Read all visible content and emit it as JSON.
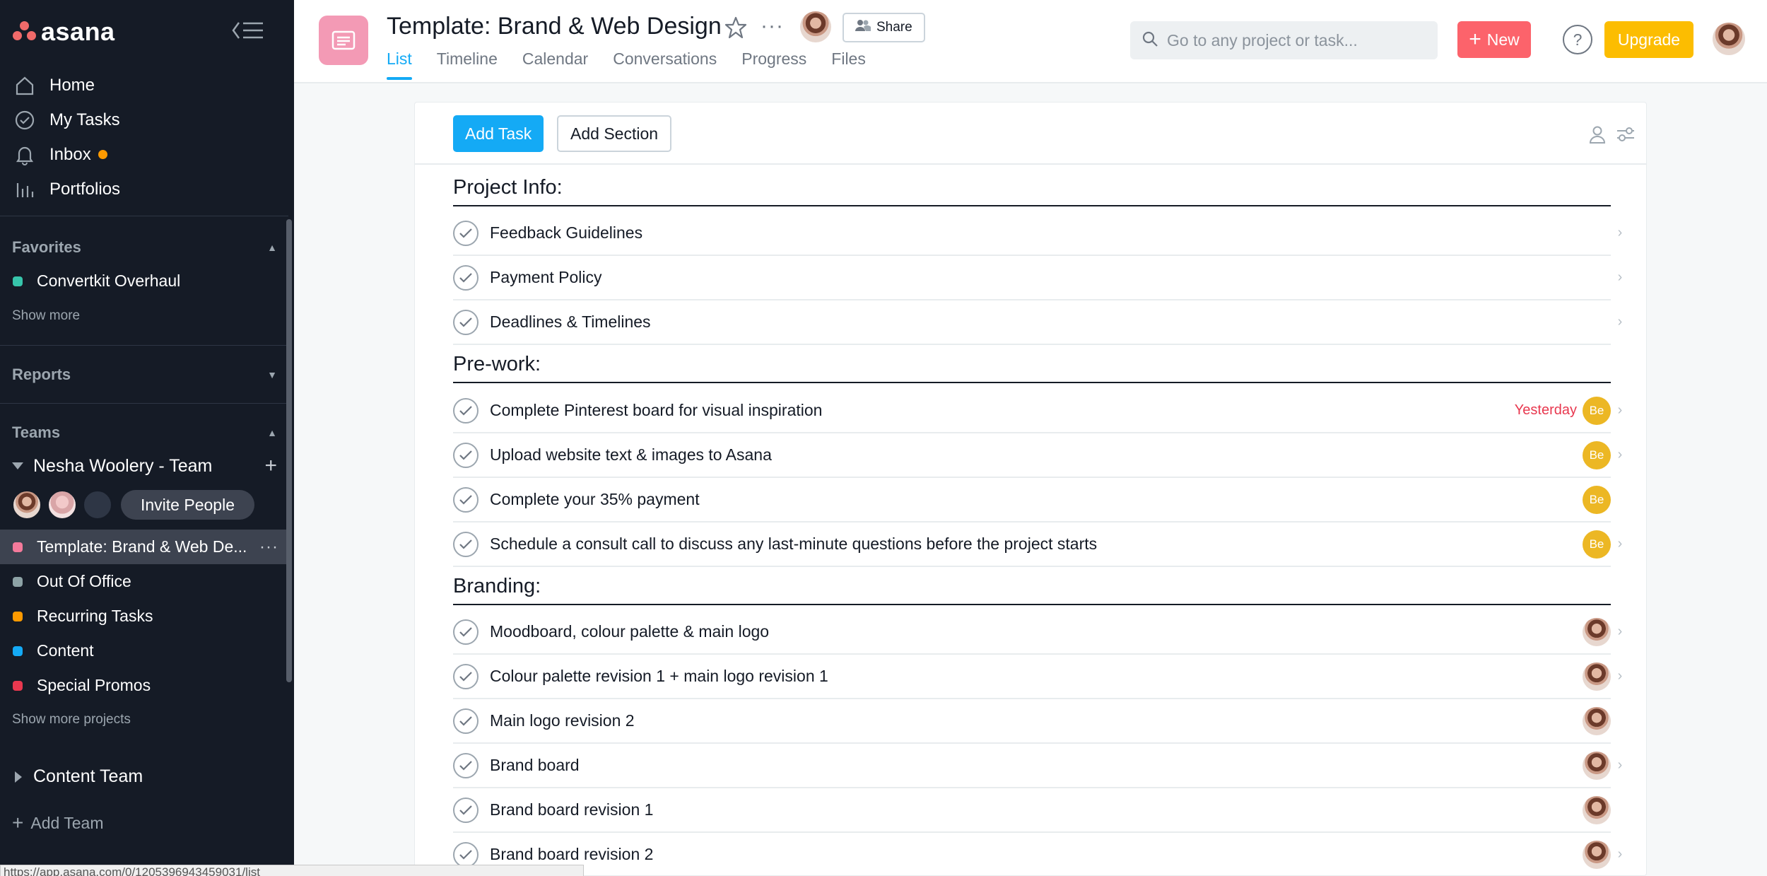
{
  "sidebar": {
    "brand": "asana",
    "nav": [
      {
        "label": "Home",
        "icon": "home-icon"
      },
      {
        "label": "My Tasks",
        "icon": "check-circle-icon"
      },
      {
        "label": "Inbox",
        "icon": "bell-icon"
      },
      {
        "label": "Portfolios",
        "icon": "bar-chart-icon"
      }
    ],
    "favorites": {
      "title": "Favorites",
      "items": [
        {
          "label": "Convertkit Overhaul",
          "color": "#37c5ab"
        }
      ],
      "show_more": "Show more"
    },
    "reports": {
      "title": "Reports"
    },
    "teams": {
      "title": "Teams",
      "team_name": "Nesha Woolery - Team",
      "invite": "Invite People",
      "projects": [
        {
          "label": "Template: Brand & Web De...",
          "color": "#f47a9b"
        },
        {
          "label": "Out Of Office",
          "color": "#8da3a6"
        },
        {
          "label": "Recurring Tasks",
          "color": "#fd9a00"
        },
        {
          "label": "Content",
          "color": "#14aaf5"
        },
        {
          "label": "Special Promos",
          "color": "#e8384f"
        }
      ],
      "show_more_projects": "Show more projects",
      "other_team": "Content Team",
      "add_team": "Add Team"
    }
  },
  "header": {
    "title": "Template: Brand & Web Design",
    "share": "Share",
    "tabs": [
      "List",
      "Timeline",
      "Calendar",
      "Conversations",
      "Progress",
      "Files"
    ],
    "search_placeholder": "Go to any project or task...",
    "new": "New",
    "help": "?",
    "upgrade": "Upgrade"
  },
  "actions": {
    "add_task": "Add Task",
    "add_section": "Add Section"
  },
  "sections": [
    {
      "title": "Project Info:",
      "tasks": [
        {
          "name": "Feedback Guidelines"
        },
        {
          "name": "Payment Policy"
        },
        {
          "name": "Deadlines & Timelines"
        }
      ]
    },
    {
      "title": "Pre-work:",
      "tasks": [
        {
          "name": "Complete Pinterest board for visual inspiration",
          "due": "Yesterday",
          "assignee": "Be"
        },
        {
          "name": "Upload website text & images to Asana",
          "assignee": "Be"
        },
        {
          "name": "Complete your 35% payment",
          "assignee": "Be"
        },
        {
          "name": "Schedule a consult call to discuss any last-minute questions before the project starts",
          "assignee": "Be"
        }
      ]
    },
    {
      "title": "Branding:",
      "tasks": [
        {
          "name": "Moodboard, colour palette & main logo",
          "assignee": "photo"
        },
        {
          "name": "Colour palette revision 1 + main logo revision 1",
          "assignee": "photo"
        },
        {
          "name": "Main logo revision 2",
          "assignee": "photo"
        },
        {
          "name": "Brand board",
          "assignee": "photo"
        },
        {
          "name": "Brand board revision 1",
          "assignee": "photo"
        },
        {
          "name": "Brand board revision 2",
          "assignee": "photo"
        }
      ]
    }
  ],
  "status_url": "https://app.asana.com/0/1205396943459031/list"
}
